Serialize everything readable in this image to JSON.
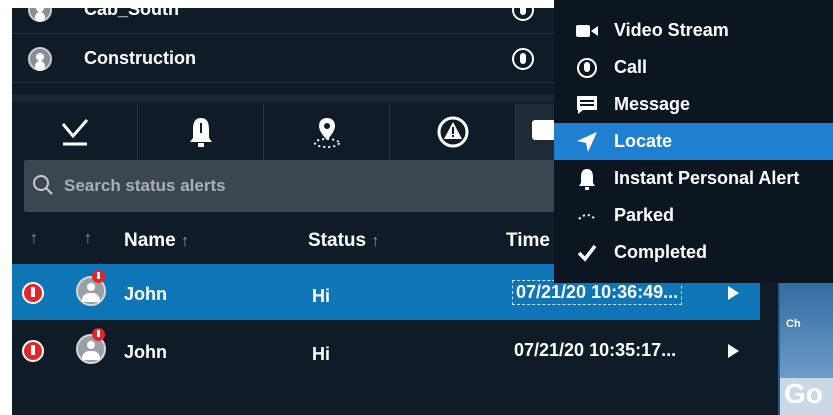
{
  "groups": [
    {
      "name": "Cab_South"
    },
    {
      "name": "Construction"
    }
  ],
  "tabs": [
    {
      "icon": "checkmark-tab-icon"
    },
    {
      "icon": "bell-alert-icon"
    },
    {
      "icon": "location-pin-icon"
    },
    {
      "icon": "warning-icon"
    },
    {
      "icon": "message-icon"
    }
  ],
  "search": {
    "placeholder": "Search status alerts"
  },
  "table": {
    "headers": {
      "name": "Name",
      "status": "Status",
      "time": "Time"
    },
    "rows": [
      {
        "name": "John",
        "status": "Hi",
        "time": "07/21/20 10:36:49...",
        "selected": true
      },
      {
        "name": "John",
        "status": "Hi",
        "time": "07/21/20 10:35:17...",
        "selected": false
      }
    ]
  },
  "context_menu": {
    "items": [
      {
        "label": "Video Stream",
        "icon": "video-camera-icon"
      },
      {
        "label": "Call",
        "icon": "microphone-icon"
      },
      {
        "label": "Message",
        "icon": "message-icon"
      },
      {
        "label": "Locate",
        "icon": "locate-arrow-icon",
        "active": true
      },
      {
        "label": "Instant Personal Alert",
        "icon": "bell-icon"
      },
      {
        "label": "Parked",
        "icon": "parked-icon"
      },
      {
        "label": "Completed",
        "icon": "checkmark-icon"
      }
    ]
  },
  "side_panel": {
    "map_label": "Ch",
    "logo_text": "Go"
  },
  "colors": {
    "background": "#0f1b27",
    "selected_row": "#0e75b7",
    "menu_active": "#1f7fd0",
    "alert_red": "#e2252b"
  }
}
